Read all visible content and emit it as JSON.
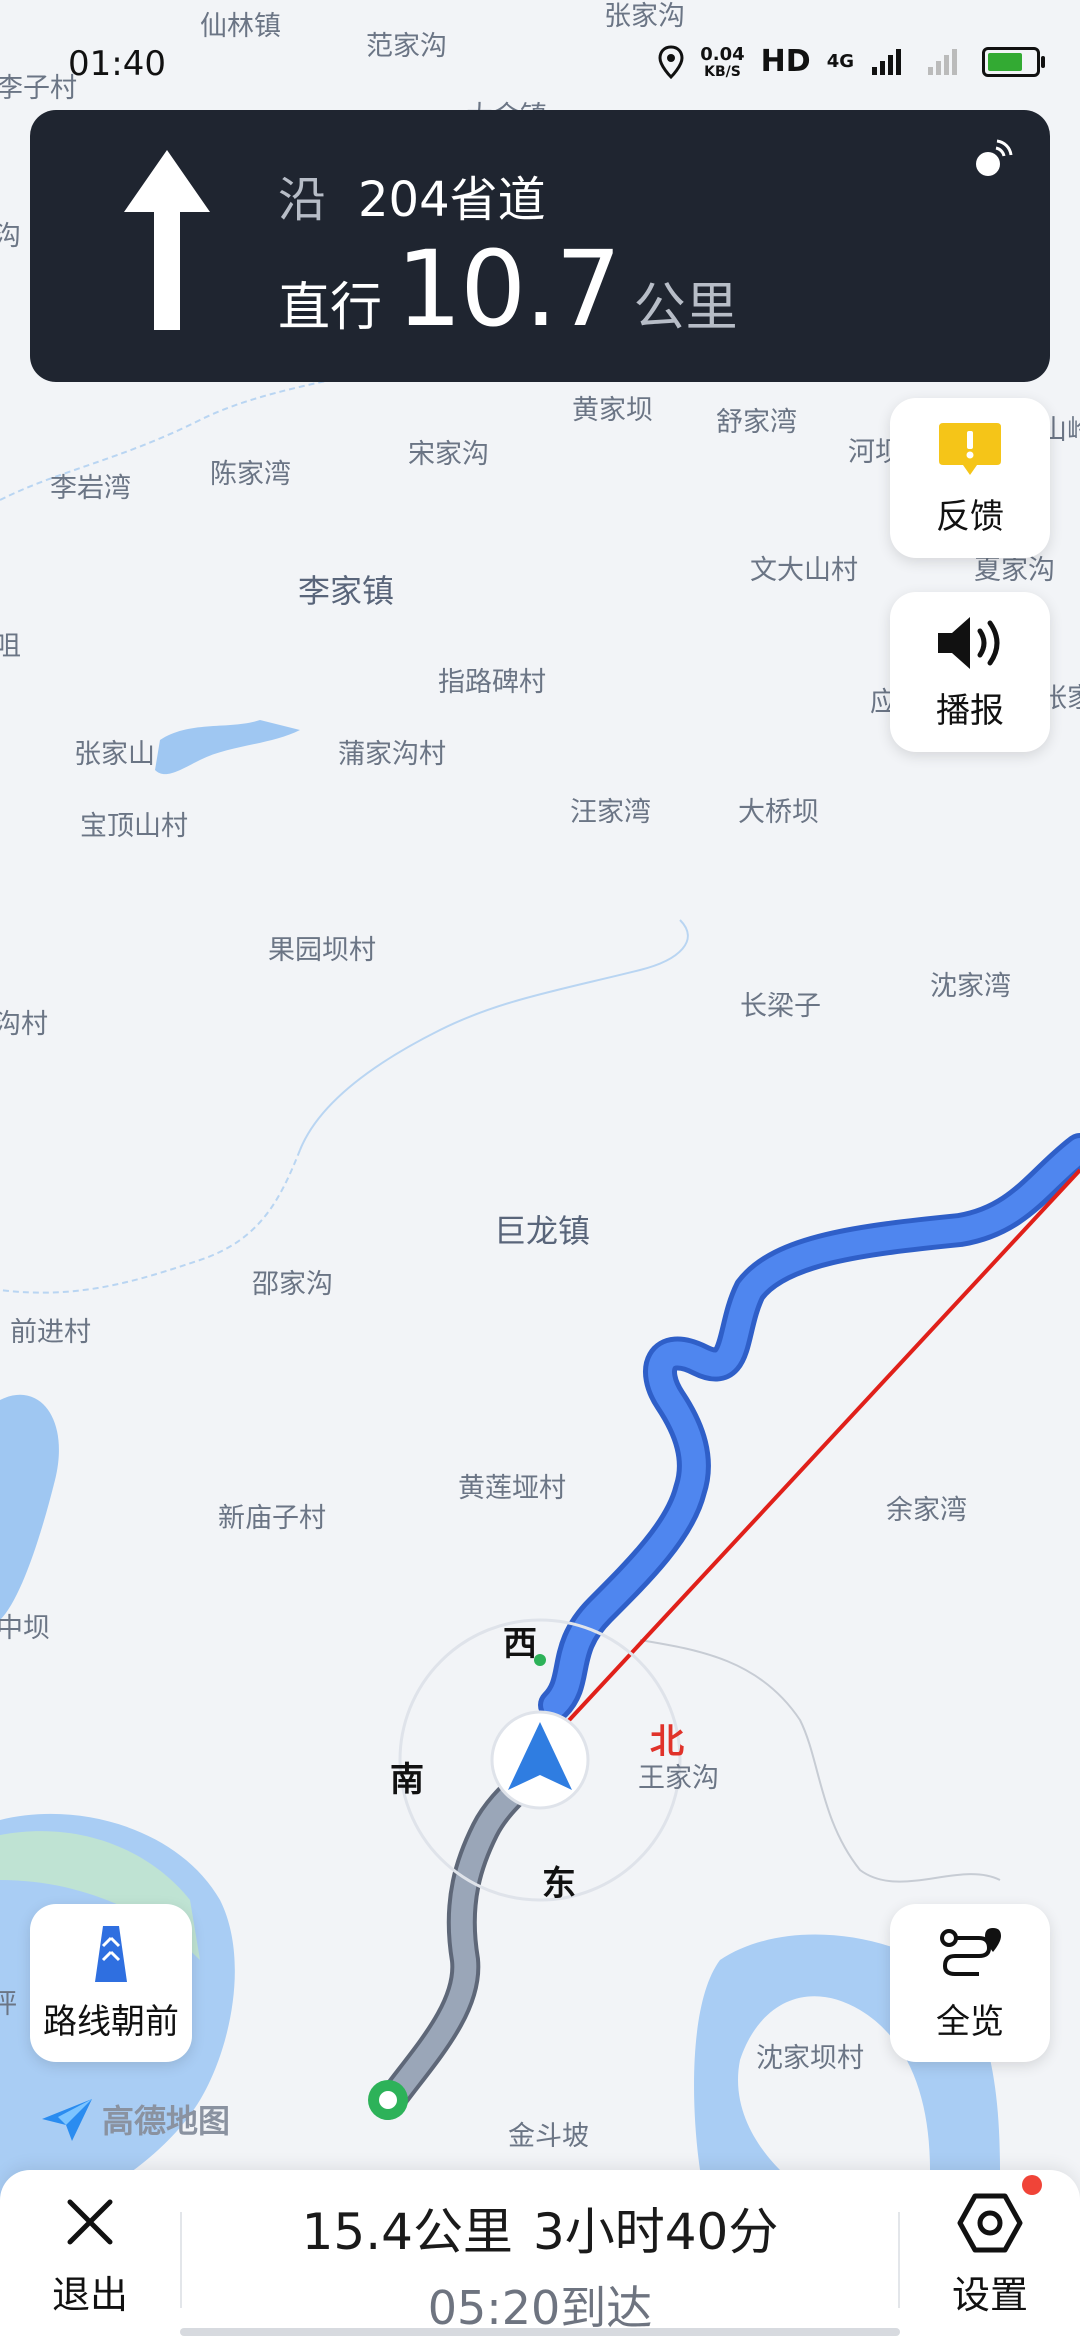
{
  "status_bar": {
    "time": "01:40",
    "net_speed": "0.04",
    "net_unit": "KB/S",
    "hd": "HD",
    "signal": "4G"
  },
  "nav": {
    "prefix": "沿",
    "road": "204省道",
    "action": "直行",
    "distance": "10.7",
    "unit": "公里"
  },
  "buttons": {
    "feedback": "反馈",
    "broadcast": "播报",
    "route_forward": "路线朝前",
    "overview": "全览"
  },
  "compass": {
    "west": "西",
    "south": "南",
    "east": "东",
    "north": "北"
  },
  "logo": "高德地图",
  "bottom": {
    "exit": "退出",
    "settings": "设置",
    "distance": "15.4公里",
    "duration": "3小时40分",
    "arrival": "05:20到达"
  },
  "places": {
    "p1": "仙林镇",
    "p2": "范家沟",
    "p3": "张家沟",
    "p4": "李子村",
    "p5": "大金镇",
    "p6": "黄家坝",
    "p7": "舒家湾",
    "p8": "河坝",
    "p9": "山岭",
    "p10": "李岩湾",
    "p11": "陈家湾",
    "p12": "宋家沟",
    "p13": "文大山村",
    "p14": "夏家沟",
    "p15": "李家镇",
    "p16": "指路碑村",
    "p17": "应",
    "p18": "张家",
    "p19": "张家山",
    "p20": "蒲家沟村",
    "p21": "宝顶山村",
    "p22": "汪家湾",
    "p23": "大桥坝",
    "p24": "果园坝村",
    "p25": "长梁子",
    "p26": "沈家湾",
    "p27": "沟村",
    "p28": "巨龙镇",
    "p29": "邵家沟",
    "p30": "前进村",
    "p31": "黄莲垭村",
    "p32": "新庙子村",
    "p33": "余家湾",
    "p34": "中坝",
    "p35": "王家沟",
    "p36": "沈家坝村",
    "p37": "金斗坡",
    "p38": "坪",
    "p39": "咀",
    "p40": "沟"
  }
}
